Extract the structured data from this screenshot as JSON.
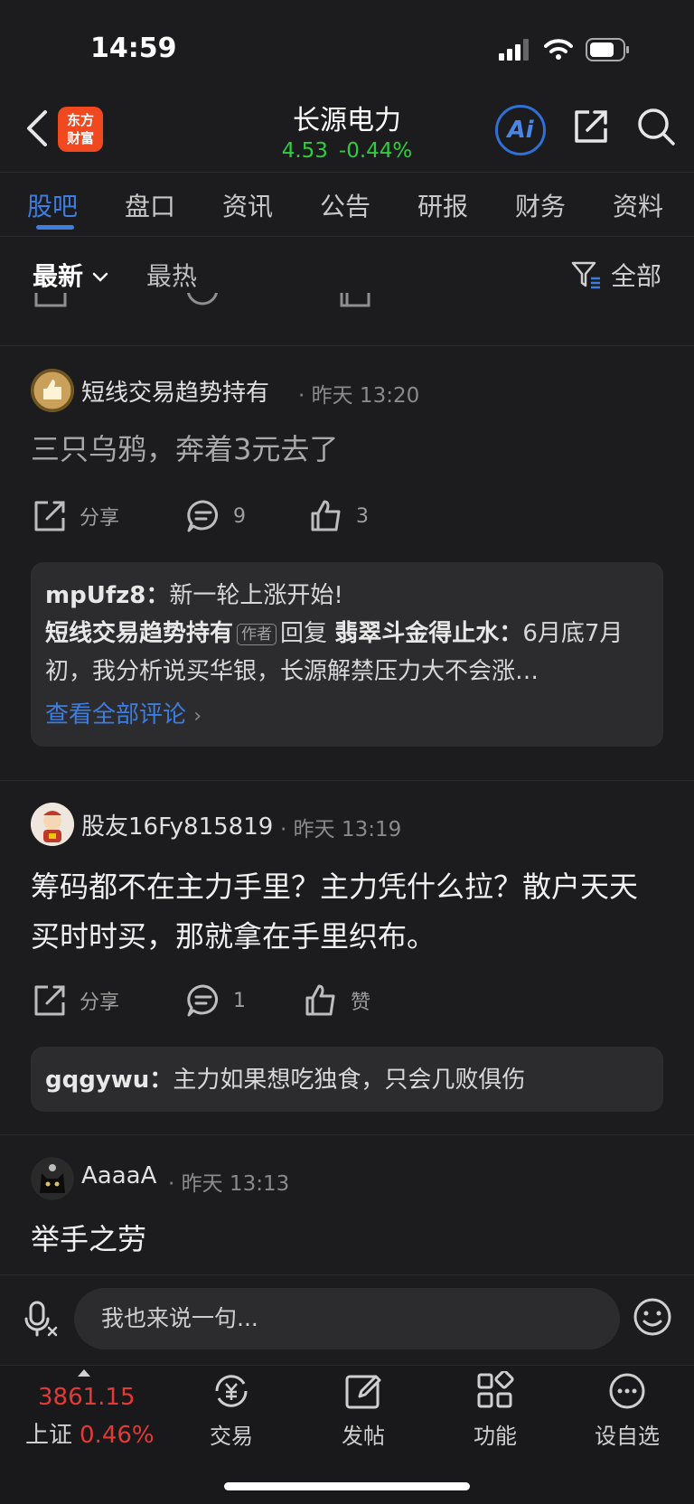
{
  "status_bar": {
    "time": "14:59"
  },
  "header": {
    "logo_line1": "东方",
    "logo_line2": "财富",
    "stock_name": "长源电力",
    "price": "4.53",
    "change_pct": "-0.44%",
    "ai_label": "Ai"
  },
  "tabs": [
    {
      "label": "股吧",
      "active": true
    },
    {
      "label": "盘口"
    },
    {
      "label": "资讯"
    },
    {
      "label": "公告"
    },
    {
      "label": "研报"
    },
    {
      "label": "财务"
    },
    {
      "label": "资料"
    }
  ],
  "sort_bar": {
    "latest": "最新",
    "hot": "最热",
    "filter": "全部"
  },
  "posts": [
    {
      "author": "短线交易趋势持有",
      "time": "昨天 13:20",
      "content": "三只乌鸦，奔着3元去了",
      "share": "分享",
      "comments": "9",
      "likes": "3",
      "replies": {
        "r1_user": "mpUfz8：",
        "r1_text": "新一轮上涨开始!",
        "r2_user": "短线交易趋势持有",
        "r2_tag": "作者",
        "r2_action": "回复",
        "r2_target": "翡翠斗金得止水：",
        "r2_text": "6月底7月初，我分析说买华银，长源解禁压力大不会涨…",
        "see_all": "查看全部评论"
      }
    },
    {
      "author": "股友16Fy815819",
      "time": "昨天 13:19",
      "content": "筹码都不在主力手里？主力凭什么拉？散户天天买时时买，那就拿在手里织布。",
      "share": "分享",
      "comments": "1",
      "likes": "赞",
      "replies": {
        "r1_user": "gqgywu：",
        "r1_text": "主力如果想吃独食，只会几败俱伤"
      }
    },
    {
      "author": "AaaaA",
      "time": "昨天 13:13",
      "content": "举手之劳"
    }
  ],
  "input_bar": {
    "placeholder": "我也来说一句..."
  },
  "bottom_nav": {
    "index_value": "3861.15",
    "index_name": "上证",
    "index_change": "0.46%",
    "items": [
      "交易",
      "发帖",
      "功能",
      "设自选"
    ]
  },
  "colors": {
    "up": "#2ecc40",
    "down": "#e53935",
    "accent": "#3d7de0",
    "background": "#1c1c1e"
  }
}
